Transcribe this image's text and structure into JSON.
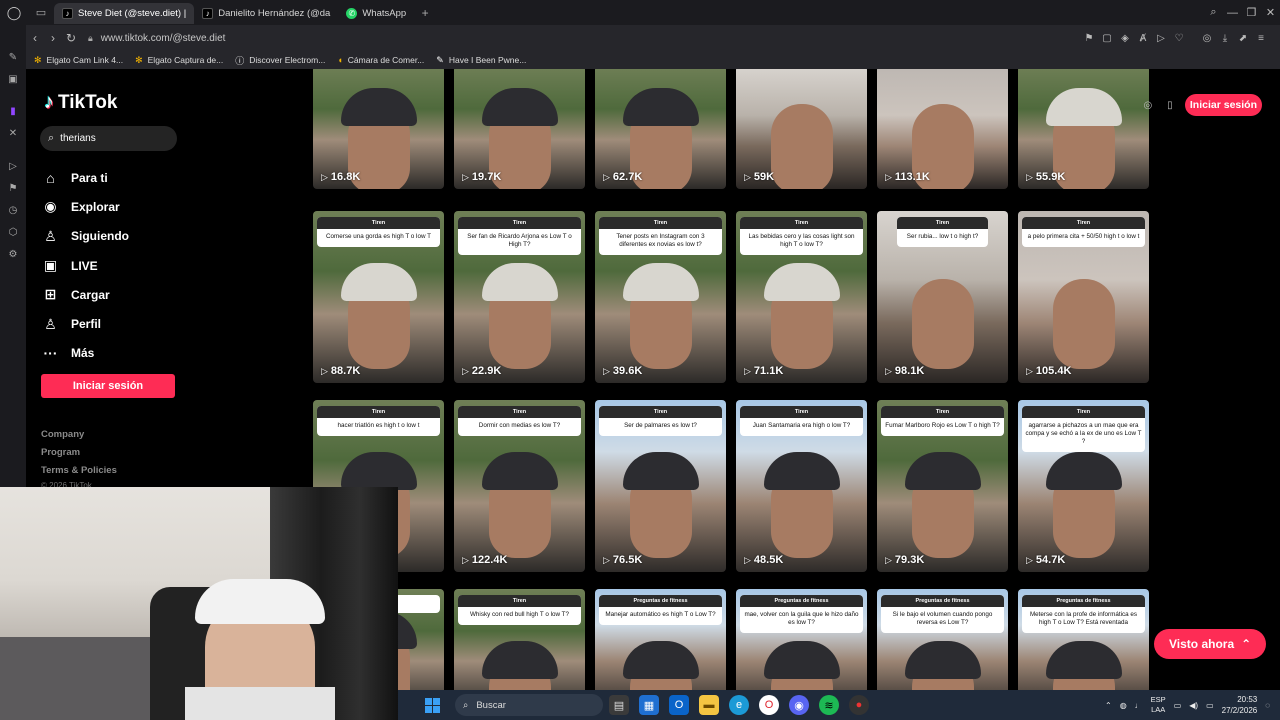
{
  "browser": {
    "tabs": [
      {
        "label": "Steve Diet (@steve.diet) |",
        "icon": "tiktok-icon",
        "active": true
      },
      {
        "label": "Danielito Hernández (@da",
        "icon": "tiktok-icon",
        "active": false
      },
      {
        "label": "WhatsApp",
        "icon": "whatsapp-icon",
        "active": false
      }
    ],
    "url": "www.tiktok.com/@steve.diet",
    "bookmarks": [
      {
        "label": "Elgato Cam Link 4...",
        "icon": "elgato-icon"
      },
      {
        "label": "Elgato Captura de...",
        "icon": "elgato-icon"
      },
      {
        "label": "Discover Electrom...",
        "icon": "info-icon"
      },
      {
        "label": "Cámara de Comer...",
        "icon": "bookmark-icon"
      },
      {
        "label": "Have I Been Pwne...",
        "icon": "pwned-icon"
      }
    ]
  },
  "tiktok": {
    "brand": "TikTok",
    "search_value": "therians",
    "menu": [
      {
        "label": "Para ti",
        "icon": "home-icon"
      },
      {
        "label": "Explorar",
        "icon": "compass-icon"
      },
      {
        "label": "Siguiendo",
        "icon": "following-icon"
      },
      {
        "label": "LIVE",
        "icon": "live-icon"
      },
      {
        "label": "Cargar",
        "icon": "upload-icon"
      },
      {
        "label": "Perfil",
        "icon": "profile-icon"
      },
      {
        "label": "Más",
        "icon": "more-icon"
      }
    ],
    "login_label": "Iniciar sesión",
    "footer": [
      "Company",
      "Program",
      "Terms & Policies"
    ],
    "copyright": "© 2026 TikTok",
    "top_login_label": "Iniciar sesión",
    "visto_label": "Visto ahora",
    "accent": "#fe2c55",
    "videos": [
      {
        "views": "16.8K",
        "header": "",
        "text": "",
        "scene": "forest",
        "cap": "dark"
      },
      {
        "views": "19.7K",
        "header": "",
        "text": "",
        "scene": "forest",
        "cap": "dark"
      },
      {
        "views": "62.7K",
        "header": "",
        "text": "",
        "scene": "forest",
        "cap": "dark"
      },
      {
        "views": "59K",
        "header": "",
        "text": "",
        "scene": "bed",
        "cap": "none"
      },
      {
        "views": "113.1K",
        "header": "",
        "text": "",
        "scene": "room",
        "cap": "none"
      },
      {
        "views": "55.9K",
        "header": "",
        "text": "",
        "scene": "forest",
        "cap": "white"
      },
      {
        "views": "88.7K",
        "header": "Tiren",
        "text": "Comerse una gorda es high T o low T",
        "scene": "forest",
        "cap": "white"
      },
      {
        "views": "22.9K",
        "header": "Tiren",
        "text": "Ser fan de Ricardo Arjona es Low T o High T?",
        "scene": "forest",
        "cap": "white"
      },
      {
        "views": "39.6K",
        "header": "Tiren",
        "text": "Tener posts en Instagram con 3 diferentes ex novias es low t?",
        "scene": "forest",
        "cap": "white"
      },
      {
        "views": "71.1K",
        "header": "Tiren",
        "text": "Las bebidas cero y las cosas light son high T o low T?",
        "scene": "forest",
        "cap": "white"
      },
      {
        "views": "98.1K",
        "header": "Tiren",
        "text": "Ser rubia... low t o high t?",
        "scene": "bed",
        "cap": "none"
      },
      {
        "views": "105.4K",
        "header": "Tiren",
        "text": "a pelo primera cita + 50/50 high t o low t",
        "scene": "room",
        "cap": "none"
      },
      {
        "views": "",
        "header": "Tiren",
        "text": "hacer triatlón es high t o low t",
        "scene": "forest",
        "cap": "dark"
      },
      {
        "views": "122.4K",
        "header": "Tiren",
        "text": "Dormir con medias es low T?",
        "scene": "forest",
        "cap": "dark"
      },
      {
        "views": "76.5K",
        "header": "Tiren",
        "text": "Ser de palmares es low t?",
        "scene": "sky",
        "cap": "dark"
      },
      {
        "views": "48.5K",
        "header": "Tiren",
        "text": "Juan Santamaria era high o low T?",
        "scene": "sky",
        "cap": "dark"
      },
      {
        "views": "79.3K",
        "header": "Tiren",
        "text": "Fumar Marlboro Rojo es Low T o high T?",
        "scene": "forest",
        "cap": "dark"
      },
      {
        "views": "54.7K",
        "header": "Tiren",
        "text": "agarrarse a pichazos a un mae que era compa y se echó a la ex de uno es Low T ?",
        "scene": "sky",
        "cap": "dark"
      },
      {
        "views": "",
        "header": "",
        "text": "low t",
        "scene": "forest",
        "cap": "dark"
      },
      {
        "views": "",
        "header": "Tiren",
        "text": "Whisky con red bull high T o low T?",
        "scene": "forest",
        "cap": "dark"
      },
      {
        "views": "",
        "header": "Preguntas de fitness",
        "text": "Manejar automático es high T o Low T?",
        "scene": "sky",
        "cap": "dark"
      },
      {
        "views": "",
        "header": "Preguntas de fitness",
        "text": "mae, volver con la guila que le hizo daño es low T?",
        "scene": "sky",
        "cap": "dark"
      },
      {
        "views": "",
        "header": "Preguntas de fitness",
        "text": "Si le bajo el volumen cuando pongo reversa es Low T?",
        "scene": "sky",
        "cap": "dark"
      },
      {
        "views": "",
        "header": "Preguntas de fitness",
        "text": "Meterse con la profe de informática es high T o Low T? Está reventada",
        "scene": "sky",
        "cap": "dark"
      }
    ]
  },
  "taskbar": {
    "search_placeholder": "Buscar",
    "lang_top": "ESP",
    "lang_bottom": "LAA",
    "time": "20:53",
    "date": "27/2/2026"
  }
}
